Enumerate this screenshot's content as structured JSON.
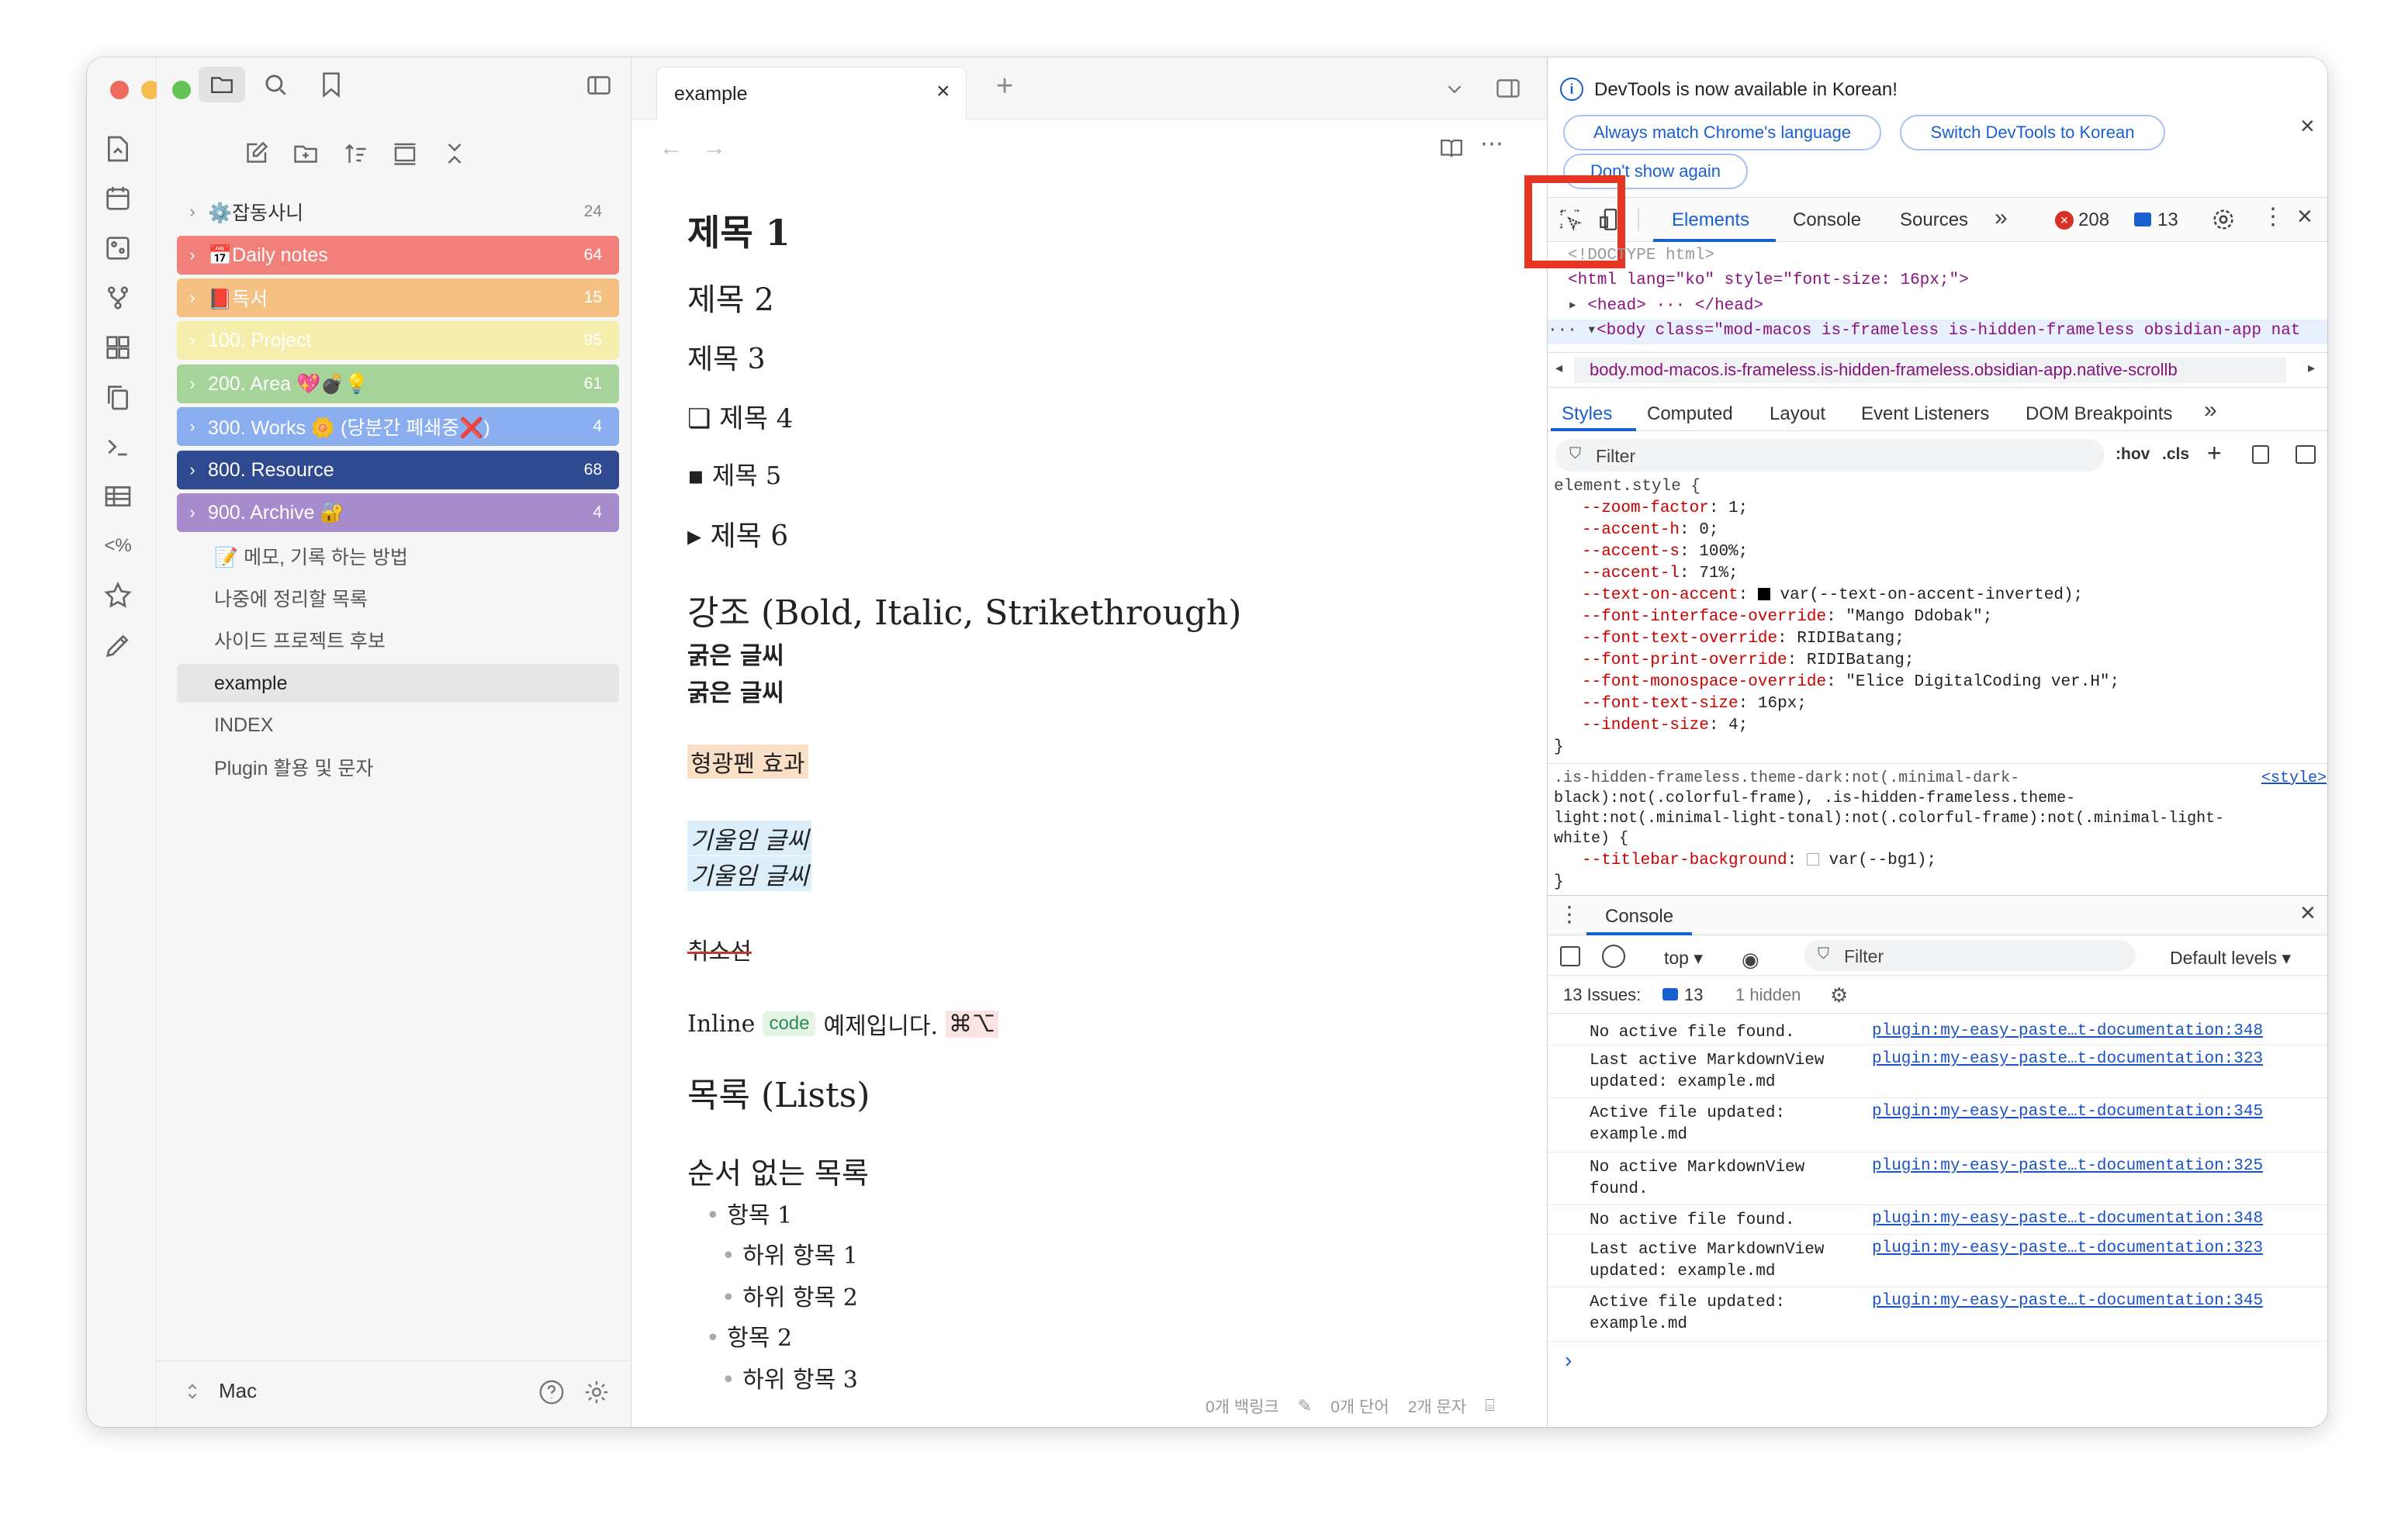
{
  "window": {
    "traffic_lights": {
      "close": "#ee6a5f",
      "minimize": "#f5bd4f",
      "maximize": "#61c454"
    }
  },
  "ribbon": {
    "icons": [
      "open-quick-switcher-icon",
      "calendar-icon",
      "graph-view-icon",
      "git-branch-icon",
      "dashboard-icon",
      "copy-icon",
      "terminal-icon",
      "table-icon",
      "template-icon",
      "star-icon",
      "pen-icon"
    ]
  },
  "sidebar": {
    "folders": [
      {
        "label": "⚙️잡동사니",
        "count": "24",
        "color": ""
      },
      {
        "label": "📅Daily notes",
        "count": "64",
        "color": "#f08079"
      },
      {
        "label": "📕독서",
        "count": "15",
        "color": "#f5c183"
      },
      {
        "label": "100. Project",
        "count": "95",
        "color": "#f5eeac"
      },
      {
        "label": "200. Area 💖💣💡",
        "count": "61",
        "color": "#a6d39a"
      },
      {
        "label": "300. Works 🌼 (당분간 폐쇄중❌)",
        "count": "4",
        "color": "#8aaef0"
      },
      {
        "label": "800. Resource",
        "count": "68",
        "color": "#2f4a91"
      },
      {
        "label": "900. Archive 🔐",
        "count": "4",
        "color": "#a68ccc"
      }
    ],
    "files": [
      "📝 메모, 기록 하는 방법",
      "나중에 정리할 목록",
      "사이드 프로젝트 후보",
      "example",
      "INDEX",
      "Plugin 활용 및 문자"
    ],
    "vault_name": "Mac"
  },
  "editor": {
    "tab_title": "example",
    "headings": {
      "h1": "제목 1",
      "h2": "제목 2",
      "h3": "제목 3",
      "h4": "❏ 제목 4",
      "h5": "▪ 제목 5",
      "h6": "▸ 제목 6"
    },
    "emphasis_title": "강조 (Bold, Italic, Strikethrough)",
    "bold1": "굵은 글씨",
    "bold2": "굵은 글씨",
    "highlight": "형광펜 효과",
    "italic1": "기울임 글씨",
    "italic2": "기울임 글씨",
    "strike": "취소선",
    "inline_prefix": "Inline",
    "inline_code": "code",
    "inline_suffix": "예제입니다.",
    "cursor_keys": "⌘⌥",
    "lists_title": "목록 (Lists)",
    "unordered_title": "순서 없는 목록",
    "items": [
      "항목 1",
      "하위 항목 1",
      "하위 항목 2",
      "항목 2",
      "하위 항목 3"
    ],
    "status": {
      "backlinks": "0개 백링크",
      "words": "0개 단어",
      "chars": "2개 문자"
    }
  },
  "devtools": {
    "banner": "DevTools is now available in Korean!",
    "buttons": [
      "Always match Chrome's language",
      "Switch DevTools to Korean",
      "Don't show again"
    ],
    "tabs": [
      "Elements",
      "Console",
      "Sources"
    ],
    "errors": "208",
    "messages": "13",
    "dom": {
      "doctype": "<!DOCTYPE html>",
      "html_line": "<html lang=\"ko\" style=\"font-size: 16px;\">",
      "head_line": "<head> ··· </head>",
      "body_line": "<body class=\"mod-macos is-frameless is-hidden-frameless obsidian-app nat"
    },
    "breadcrumb": "body.mod-macos.is-frameless.is-hidden-frameless.obsidian-app.native-scrollb",
    "style_tabs": [
      "Styles",
      "Computed",
      "Layout",
      "Event Listeners",
      "DOM Breakpoints"
    ],
    "filter_placeholder": "Filter",
    "hov": ":hov",
    "cls": ".cls",
    "element_style": [
      {
        "p": "--zoom-factor",
        "v": "1;"
      },
      {
        "p": "--accent-h",
        "v": "0;"
      },
      {
        "p": "--accent-s",
        "v": "100%;"
      },
      {
        "p": "--accent-l",
        "v": "71%;"
      },
      {
        "p": "--text-on-accent",
        "v": "var(--text-on-accent-inverted);"
      },
      {
        "p": "--font-interface-override",
        "v": "\"Mango Ddobak\";"
      },
      {
        "p": "--font-text-override",
        "v": "RIDIBatang;"
      },
      {
        "p": "--font-print-override",
        "v": "RIDIBatang;"
      },
      {
        "p": "--font-monospace-override",
        "v": "\"Elice DigitalCoding ver.H\";"
      },
      {
        "p": "--font-text-size",
        "v": "16px;"
      },
      {
        "p": "--indent-size",
        "v": "4;"
      }
    ],
    "rule2_selector": [
      ".is-hidden-frameless.theme-dark:not(.minimal-dark-",
      "black):not(.colorful-frame), .is-hidden-frameless.theme-",
      "light:not(.minimal-light-tonal):not(.colorful-frame):not(.minimal-light-",
      "white) {"
    ],
    "rule2_source": "<style>",
    "rule2_prop": "--titlebar-background",
    "rule2_val": "var(--bg1);",
    "console_title": "Console",
    "console_context": "top",
    "console_filter": "Filter",
    "console_levels": "Default levels",
    "issues_label": "13 Issues:",
    "issues_count": "13",
    "hidden": "1 hidden",
    "logs": [
      {
        "msg": "No active file found.",
        "src": "plugin:my-easy-paste…t-documentation:348"
      },
      {
        "msg": "Last active MarkdownView updated: example.md",
        "src": "plugin:my-easy-paste…t-documentation:323"
      },
      {
        "msg": "Active file updated: example.md",
        "src": "plugin:my-easy-paste…t-documentation:345"
      },
      {
        "msg": "No active MarkdownView found.",
        "src": "plugin:my-easy-paste…t-documentation:325"
      },
      {
        "msg": "No active file found.",
        "src": "plugin:my-easy-paste…t-documentation:348"
      },
      {
        "msg": "Last active MarkdownView updated: example.md",
        "src": "plugin:my-easy-paste…t-documentation:323"
      },
      {
        "msg": "Active file updated: example.md",
        "src": "plugin:my-easy-paste…t-documentation:345"
      }
    ],
    "prompt": "›"
  }
}
